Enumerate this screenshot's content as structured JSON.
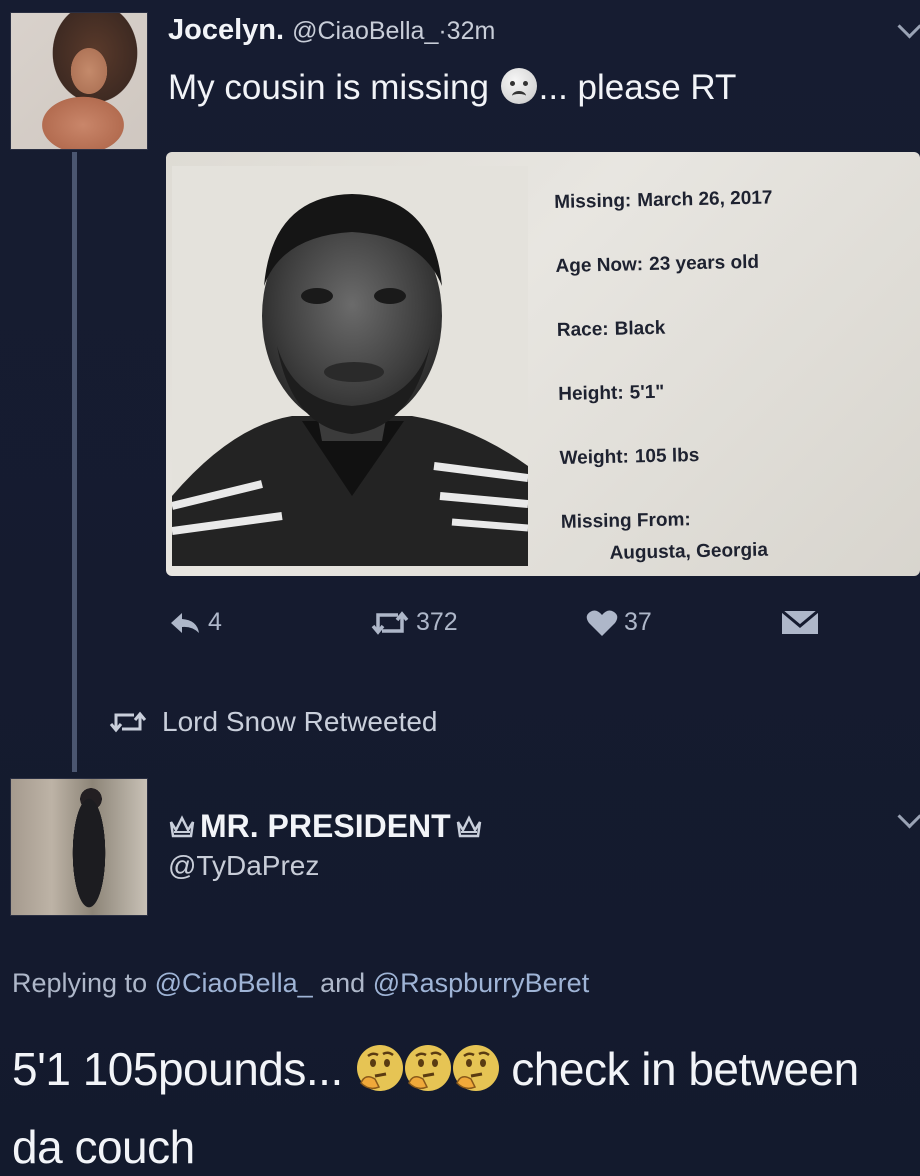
{
  "tweet1": {
    "author_name": "Jocelyn.",
    "author_handle": "@CiaoBella_",
    "time": "·32m",
    "text_before": "My cousin is missing",
    "text_after": "... please RT",
    "emoji": "disappointed-face",
    "actions": {
      "replies": "4",
      "retweets": "372",
      "likes": "37"
    }
  },
  "flyer": {
    "missing_label": "Missing:",
    "missing_value": "March 26, 2017",
    "age_label": "Age Now:",
    "age_value": "23 years old",
    "race_label": "Race:",
    "race_value": "Black",
    "height_label": "Height:",
    "height_value": "5'1\"",
    "weight_label": "Weight:",
    "weight_value": "105 lbs",
    "from_label": "Missing From:",
    "from_value": "Augusta, Georgia"
  },
  "retweet_notice": "Lord Snow Retweeted",
  "tweet2": {
    "author_name": "MR. PRESIDENT",
    "author_handle": "@TyDaPrez",
    "replying_prefix": "Replying to",
    "replying_user1": "@CiaoBella_",
    "replying_and": "and",
    "replying_user2": "@RaspburryBeret",
    "text_before": "5'1 105pounds...",
    "text_after": "check in between da couch",
    "emoji": "thinking-face",
    "emoji_count": 3
  },
  "colors": {
    "background": "#151b2f",
    "thread_line": "#4b5670",
    "muted_text": "#aeb7c9",
    "link": "#9fb4d6"
  },
  "icons": [
    "reply-icon",
    "retweet-icon",
    "heart-icon",
    "dm-icon",
    "crown-icon",
    "chevron-down-icon"
  ]
}
